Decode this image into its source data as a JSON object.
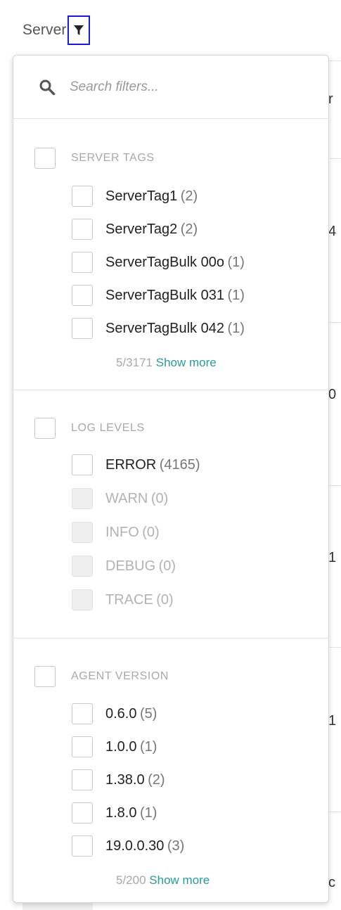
{
  "header": {
    "label": "Server"
  },
  "search": {
    "placeholder": "Search filters..."
  },
  "groups": [
    {
      "title": "SERVER TAGS",
      "items": [
        {
          "label": "ServerTag1",
          "count": "(2)"
        },
        {
          "label": "ServerTag2",
          "count": "(2)"
        },
        {
          "label": "ServerTagBulk 00o",
          "count": "(1)"
        },
        {
          "label": "ServerTagBulk 031",
          "count": "(1)"
        },
        {
          "label": "ServerTagBulk 042",
          "count": "(1)"
        }
      ],
      "shown": "5/3171",
      "show_more": "Show more"
    },
    {
      "title": "LOG LEVELS",
      "items": [
        {
          "label": "ERROR",
          "count": "(4165)"
        },
        {
          "label": "WARN",
          "count": "(0)"
        },
        {
          "label": "INFO",
          "count": "(0)"
        },
        {
          "label": "DEBUG",
          "count": "(0)"
        },
        {
          "label": "TRACE",
          "count": "(0)"
        }
      ]
    },
    {
      "title": "AGENT VERSION",
      "items": [
        {
          "label": "0.6.0",
          "count": "(5)"
        },
        {
          "label": "1.0.0",
          "count": "(1)"
        },
        {
          "label": "1.38.0",
          "count": "(2)"
        },
        {
          "label": "1.8.0",
          "count": "(1)"
        },
        {
          "label": "19.0.0.30",
          "count": "(3)"
        }
      ],
      "shown": "5/200",
      "show_more": "Show more"
    }
  ],
  "background_cells": [
    "r",
    "4",
    "0",
    "1",
    "1",
    "c"
  ]
}
